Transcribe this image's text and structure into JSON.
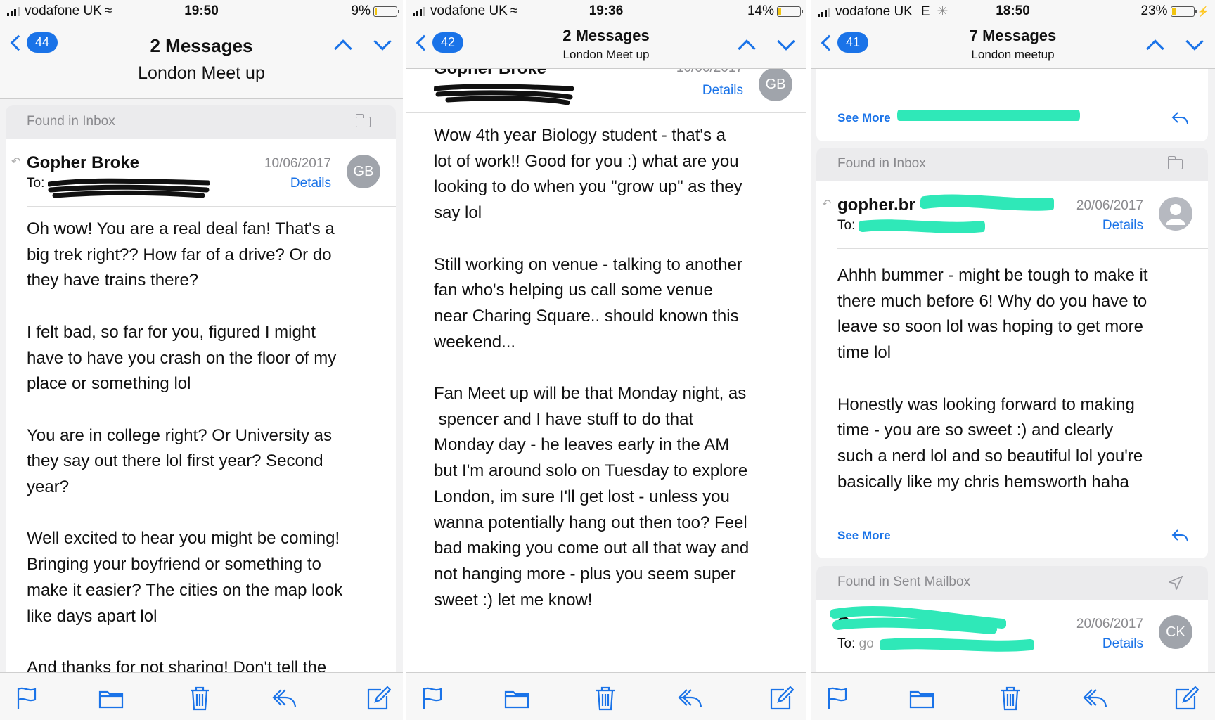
{
  "panels": [
    {
      "status": {
        "carrier": "vodafone UK",
        "time": "19:50",
        "battery": "9%",
        "battery_level": 0.09
      },
      "nav": {
        "back_count": "44",
        "title": "2 Messages",
        "subtitle": "London Meet up"
      },
      "found_label": "Found in Inbox",
      "message": {
        "sender": "Gopher Broke",
        "to_label": "To:",
        "date": "10/06/2017",
        "details_label": "Details",
        "avatar": "GB",
        "body": "Oh wow! You are a real deal fan! That's a\nbig trek right?? How far of a drive? Or do\nthey have trains there?\n\nI felt bad, so far for you, figured I might\nhave to have you crash on the floor of my\nplace or something lol\n\nYou are in college right? Or University as\nthey say out there lol first year? Second\nyear?\n\nWell excited to hear you might be coming!\nBringing your boyfriend or something to\nmake it easier? The cities on the map look\nlike days apart lol\n\nAnd thanks for not sharing! Don't tell the"
      }
    },
    {
      "status": {
        "carrier": "vodafone UK",
        "time": "19:36",
        "battery": "14%",
        "battery_level": 0.14
      },
      "nav": {
        "back_count": "42",
        "title": "2 Messages",
        "subtitle": "London Meet up"
      },
      "message": {
        "sender_partial": "Gopher Broke",
        "date_partial": "10/06/2017",
        "details_label": "Details",
        "avatar": "GB",
        "body": "Wow 4th year Biology student - that's a\nlot of work!! Good for you :) what are you\nlooking to do when you \"grow up\" as they\nsay lol\n\nStill working on venue - talking to another\nfan who's helping us call some venue\nnear Charing Square.. should known this\nweekend...\n\nFan Meet up will be that Monday night, as\n spencer and I have stuff to do that\nMonday day - he leaves early in the AM\nbut I'm around solo on Tuesday to explore\nLondon, im sure I'll get lost - unless you\nwanna potentially hang out then too? Feel\nbad making you come out all that way and\nnot hanging more - plus you seem super\nsweet :) let me know!"
      }
    },
    {
      "status": {
        "carrier": "vodafone UK",
        "network": "E",
        "time": "18:50",
        "battery": "23%",
        "battery_level": 0.23
      },
      "nav": {
        "back_count": "41",
        "title": "7 Messages",
        "subtitle": "London meetup"
      },
      "top_card": {
        "see_more_label": "See More"
      },
      "found_label": "Found in Inbox",
      "message": {
        "sender": "gopher.br",
        "to_label": "To:",
        "date": "20/06/2017",
        "details_label": "Details",
        "body": "Ahhh bummer - might be tough to make it\nthere much before 6! Why do you have to\nleave so soon lol was hoping to get more\ntime lol\n\nHonestly was looking forward to making\ntime - you are so sweet :) and clearly\nsuch a nerd lol and so beautiful lol you're\nbasically like my chris hemsworth haha",
        "see_more_label": "See More"
      },
      "sent_label": "Found in Sent Mailbox",
      "sent": {
        "to_label": "To:",
        "to_partial": "go",
        "date": "20/06/2017",
        "details_label": "Details",
        "avatar": "CK",
        "sender_partial": "C"
      }
    }
  ],
  "colors": {
    "accent": "#1a73e8",
    "redaction_black": "#111111",
    "redaction_green": "#2fe8b8"
  }
}
